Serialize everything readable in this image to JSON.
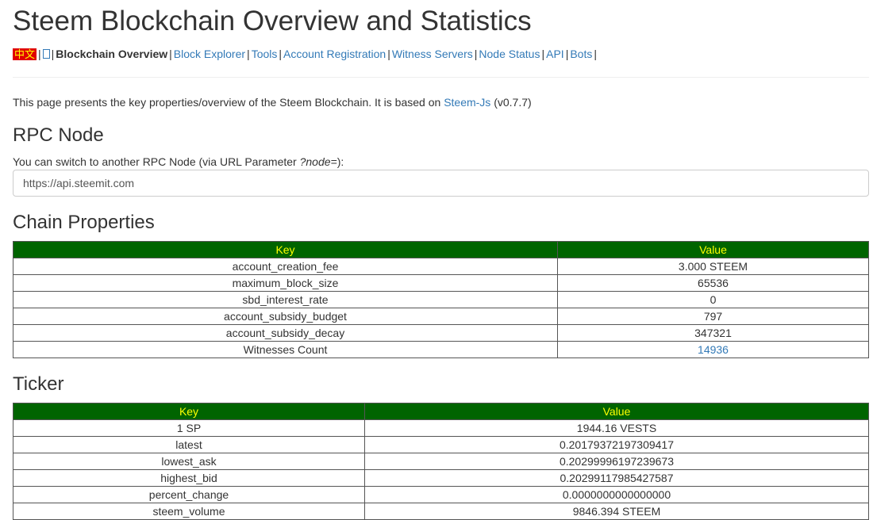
{
  "page": {
    "title": "Steem Blockchain Overview and Statistics"
  },
  "nav": {
    "chinese": "中文",
    "current": "Blockchain Overview",
    "links": [
      "Block Explorer",
      "Tools",
      "Account Registration",
      "Witness Servers",
      "Node Status",
      "API",
      "Bots"
    ]
  },
  "intro": {
    "before": "This page presents the key properties/overview of the Steem Blockchain. It is based on ",
    "link": "Steem-Js",
    "after": " (v0.7.7)"
  },
  "rpc": {
    "heading": "RPC Node",
    "note_before": "You can switch to another RPC Node (via URL Parameter ",
    "note_param": "?node=",
    "note_after": "):",
    "value": "https://api.steemit.com"
  },
  "chain": {
    "heading": "Chain Properties",
    "col_key": "Key",
    "col_value": "Value",
    "rows": [
      {
        "key": "account_creation_fee",
        "value": "3.000 STEEM"
      },
      {
        "key": "maximum_block_size",
        "value": "65536"
      },
      {
        "key": "sbd_interest_rate",
        "value": "0"
      },
      {
        "key": "account_subsidy_budget",
        "value": "797"
      },
      {
        "key": "account_subsidy_decay",
        "value": "347321"
      },
      {
        "key": "Witnesses Count",
        "value": "14936"
      }
    ]
  },
  "ticker": {
    "heading": "Ticker",
    "col_key": "Key",
    "col_value": "Value",
    "rows": [
      {
        "key": "1 SP",
        "value": "1944.16 VESTS"
      },
      {
        "key": "latest",
        "value": "0.20179372197309417"
      },
      {
        "key": "lowest_ask",
        "value": "0.20299996197239673"
      },
      {
        "key": "highest_bid",
        "value": "0.20299117985427587"
      },
      {
        "key": "percent_change",
        "value": "0.0000000000000000"
      },
      {
        "key": "steem_volume",
        "value": "9846.394 STEEM"
      }
    ]
  },
  "colors": {
    "header_bg": "#006400",
    "header_text": "#ffff00",
    "link": "#337ab7",
    "cn_badge_bg": "#e00000"
  }
}
